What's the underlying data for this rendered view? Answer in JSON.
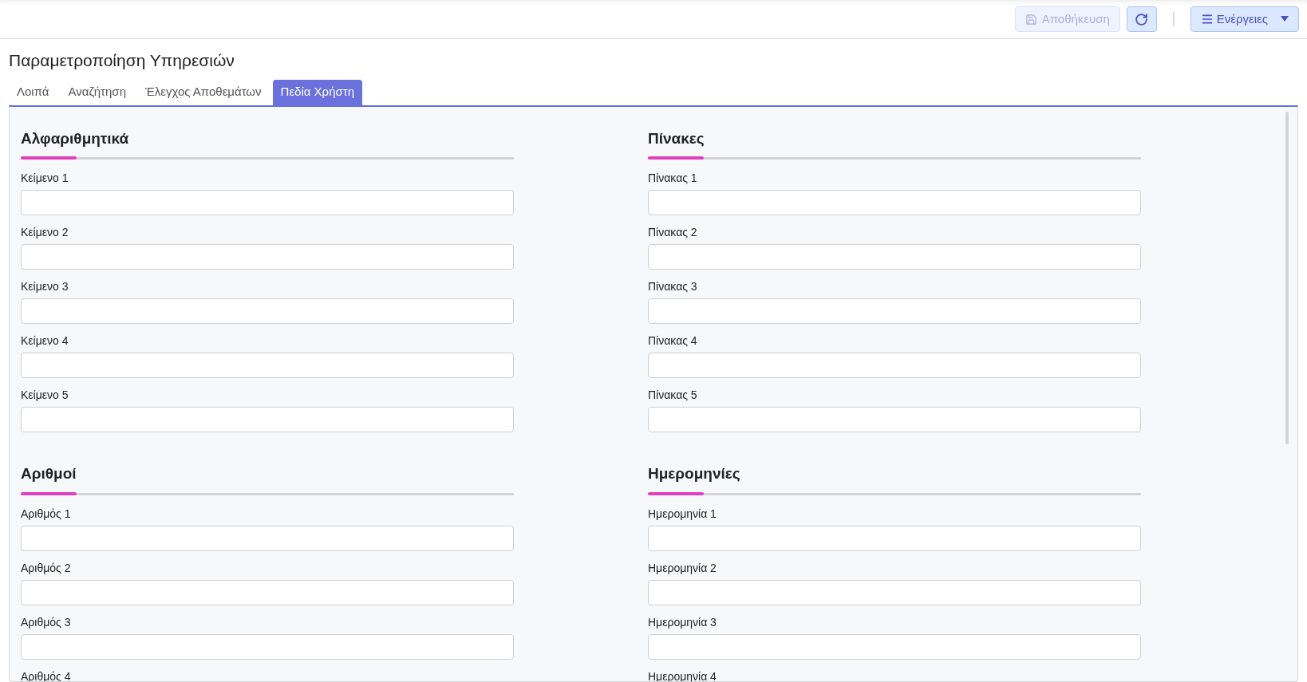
{
  "toolbar": {
    "save_button": {
      "label": "Αποθήκευση",
      "disabled": true
    },
    "actions_button": {
      "label": "Ενέργειες"
    }
  },
  "page_title": "Παραμετροποίηση Υπηρεσιών",
  "tabs": [
    {
      "label": "Λοιπά",
      "selected": false
    },
    {
      "label": "Αναζήτηση",
      "selected": false
    },
    {
      "label": "Έλεγχος Αποθεμάτων",
      "selected": false
    },
    {
      "label": "Πεδία Χρήστη",
      "selected": true
    }
  ],
  "sections": [
    {
      "title": "Αλφαριθμητικά",
      "fields": [
        "Κείμενο 1",
        "Κείμενο 2",
        "Κείμενο 3",
        "Κείμενο 4",
        "Κείμενο 5"
      ]
    },
    {
      "title": "Πίνακες",
      "fields": [
        "Πίνακας 1",
        "Πίνακας 2",
        "Πίνακας 3",
        "Πίνακας 4",
        "Πίνακας 5"
      ]
    },
    {
      "title": "Αριθμοί",
      "fields": [
        "Αριθμός 1",
        "Αριθμός 2",
        "Αριθμός 3",
        "Αριθμός 4"
      ]
    },
    {
      "title": "Ημερομηνίες",
      "fields": [
        "Ημερομηνία 1",
        "Ημερομηνία 2",
        "Ημερομηνία 3",
        "Ημερομηνία 4"
      ]
    }
  ]
}
